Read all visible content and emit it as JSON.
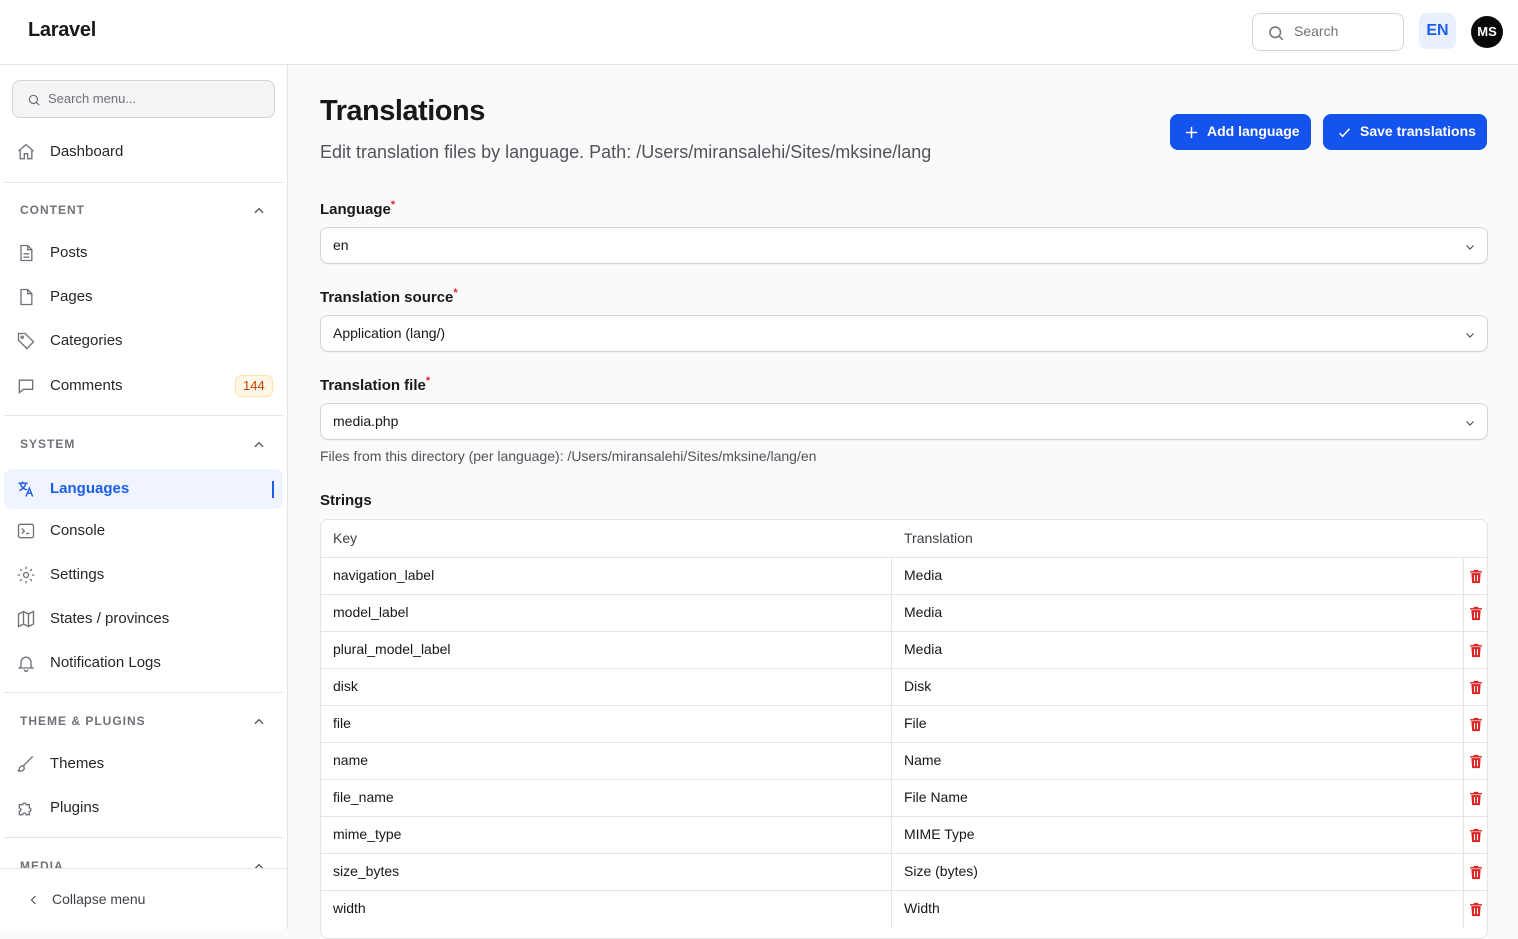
{
  "app": {
    "brand": "Laravel"
  },
  "topbar": {
    "search_placeholder": "Search",
    "language": "EN",
    "avatar_initials": "MS"
  },
  "sidebar": {
    "search_placeholder": "Search menu...",
    "dashboard": "Dashboard",
    "groups": [
      {
        "label": "CONTENT",
        "items": [
          {
            "label": "Posts",
            "icon": "document-icon"
          },
          {
            "label": "Pages",
            "icon": "page-icon"
          },
          {
            "label": "Categories",
            "icon": "tag-icon"
          },
          {
            "label": "Comments",
            "icon": "chat-icon",
            "badge": "144"
          }
        ]
      },
      {
        "label": "SYSTEM",
        "items": [
          {
            "label": "Languages",
            "icon": "translate-icon",
            "active": true
          },
          {
            "label": "Console",
            "icon": "terminal-icon"
          },
          {
            "label": "Settings",
            "icon": "gear-icon"
          },
          {
            "label": "States / provinces",
            "icon": "map-icon"
          },
          {
            "label": "Notification Logs",
            "icon": "bell-icon"
          }
        ]
      },
      {
        "label": "THEME & PLUGINS",
        "items": [
          {
            "label": "Themes",
            "icon": "brush-icon"
          },
          {
            "label": "Plugins",
            "icon": "puzzle-icon"
          }
        ]
      },
      {
        "label": "MEDIA",
        "items": []
      }
    ],
    "collapse_label": "Collapse menu"
  },
  "main": {
    "title": "Translations",
    "subtitle": "Edit translation files by language. Path: /Users/miransalehi/Sites/mksine/lang",
    "add_language": "Add language",
    "save_translations": "Save translations",
    "fields": {
      "language": {
        "label": "Language",
        "value": "en"
      },
      "source": {
        "label": "Translation source",
        "value": "Application (lang/)"
      },
      "file": {
        "label": "Translation file",
        "value": "media.php"
      }
    },
    "hint": "Files from this directory (per language): /Users/miransalehi/Sites/mksine/lang/en",
    "strings_label": "Strings",
    "table": {
      "headers": {
        "key": "Key",
        "translation": "Translation"
      },
      "rows": [
        {
          "key": "navigation_label",
          "value": "Media"
        },
        {
          "key": "model_label",
          "value": "Media"
        },
        {
          "key": "plural_model_label",
          "value": "Media"
        },
        {
          "key": "disk",
          "value": "Disk"
        },
        {
          "key": "file",
          "value": "File"
        },
        {
          "key": "name",
          "value": "Name"
        },
        {
          "key": "file_name",
          "value": "File Name"
        },
        {
          "key": "mime_type",
          "value": "MIME Type"
        },
        {
          "key": "size_bytes",
          "value": "Size (bytes)"
        },
        {
          "key": "width",
          "value": "Width"
        }
      ]
    }
  },
  "colors": {
    "accent": "#1553ef",
    "danger": "#dc2626",
    "badge_text": "#c2410c"
  }
}
